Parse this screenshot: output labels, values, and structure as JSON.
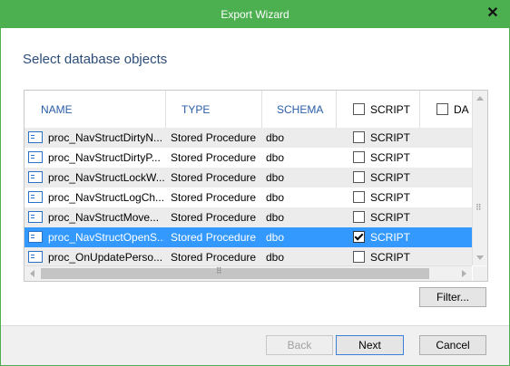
{
  "window": {
    "title": "Export Wizard"
  },
  "heading": "Select database objects",
  "columns": {
    "name": "NAME",
    "type": "TYPE",
    "schema": "SCHEMA",
    "script": "SCRIPT",
    "data": "DA"
  },
  "rows": [
    {
      "name": "proc_NavStructDirtyN...",
      "type": "Stored Procedure",
      "schema": "dbo",
      "script": "SCRIPT",
      "checked": false,
      "selected": false
    },
    {
      "name": "proc_NavStructDirtyP...",
      "type": "Stored Procedure",
      "schema": "dbo",
      "script": "SCRIPT",
      "checked": false,
      "selected": false
    },
    {
      "name": "proc_NavStructLockW...",
      "type": "Stored Procedure",
      "schema": "dbo",
      "script": "SCRIPT",
      "checked": false,
      "selected": false
    },
    {
      "name": "proc_NavStructLogCh...",
      "type": "Stored Procedure",
      "schema": "dbo",
      "script": "SCRIPT",
      "checked": false,
      "selected": false
    },
    {
      "name": "proc_NavStructMove...",
      "type": "Stored Procedure",
      "schema": "dbo",
      "script": "SCRIPT",
      "checked": false,
      "selected": false
    },
    {
      "name": "proc_NavStructOpenS...",
      "type": "Stored Procedure",
      "schema": "dbo",
      "script": "SCRIPT",
      "checked": true,
      "selected": true
    },
    {
      "name": "proc_OnUpdatePerso...",
      "type": "Stored Procedure",
      "schema": "dbo",
      "script": "SCRIPT",
      "checked": false,
      "selected": false
    }
  ],
  "buttons": {
    "filter": "Filter...",
    "back": "Back",
    "next": "Next",
    "cancel": "Cancel"
  },
  "icons": {
    "close": "close-icon",
    "object": "stored-procedure-icon"
  },
  "colors": {
    "titlebar": "#4caf50",
    "selection": "#3399ff",
    "heading": "#2c4d7a",
    "header_text": "#2a5ea8"
  }
}
